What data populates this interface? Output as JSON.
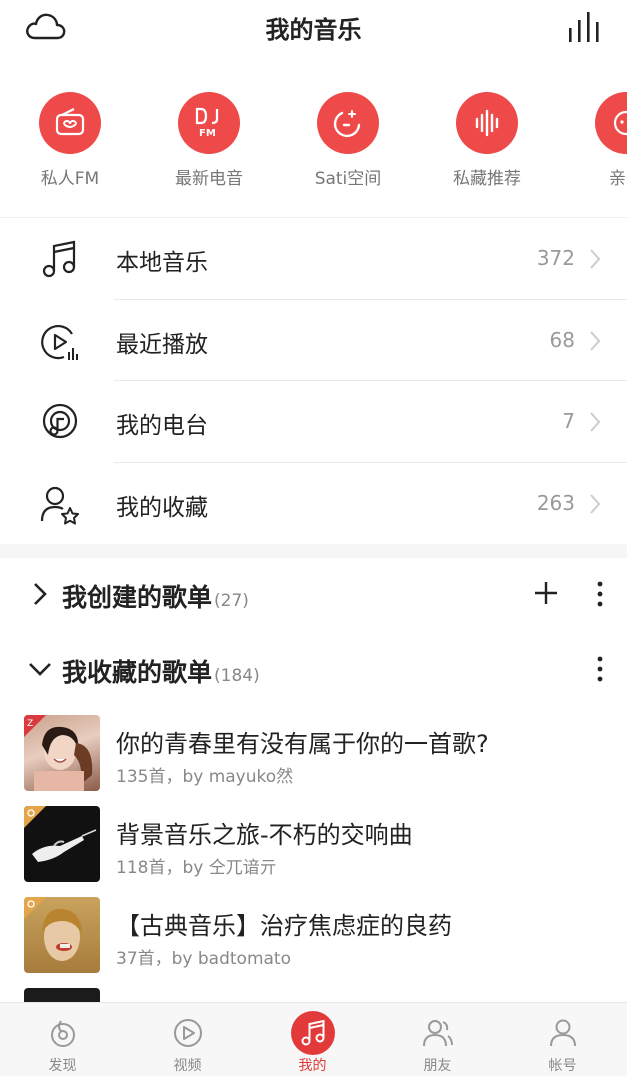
{
  "header": {
    "title": "我的音乐",
    "left_icon": "cloud-icon",
    "right_icon": "equalizer-bars-icon"
  },
  "quick_entries": [
    {
      "label": "私人FM",
      "icon": "radio-icon"
    },
    {
      "label": "最新电音",
      "icon": "dj-fm-icon"
    },
    {
      "label": "Sati空间",
      "icon": "moon-sparkle-icon"
    },
    {
      "label": "私藏推荐",
      "icon": "waveform-icon"
    },
    {
      "label": "亲子",
      "icon": "kids-face-icon"
    }
  ],
  "menu": [
    {
      "label": "本地音乐",
      "count": "372",
      "icon": "music-note-icon"
    },
    {
      "label": "最近播放",
      "count": "68",
      "icon": "recent-play-icon"
    },
    {
      "label": "我的电台",
      "count": "7",
      "icon": "podcast-icon"
    },
    {
      "label": "我的收藏",
      "count": "263",
      "icon": "user-star-icon"
    }
  ],
  "created_section": {
    "title": "我创建的歌单",
    "count": "(27)"
  },
  "collected_section": {
    "title": "我收藏的歌单",
    "count": "(184)"
  },
  "playlists": [
    {
      "name": "你的青春里有没有属于你的一首歌?",
      "meta": "135首，by mayuko然"
    },
    {
      "name": "背景音乐之旅-不朽的交响曲",
      "meta": "118首，by 仝兀谙亓"
    },
    {
      "name": "【古典音乐】治疗焦虑症的良药",
      "meta": "37首，by badtomato"
    }
  ],
  "tabs": [
    {
      "label": "发现",
      "icon": "discover-icon",
      "active": false
    },
    {
      "label": "视频",
      "icon": "video-icon",
      "active": false
    },
    {
      "label": "我的",
      "icon": "music-note-icon",
      "active": true
    },
    {
      "label": "朋友",
      "icon": "friends-icon",
      "active": false
    },
    {
      "label": "帐号",
      "icon": "account-icon",
      "active": false
    }
  ],
  "colors": {
    "accent": "#ef4a4a",
    "active_tab": "#e23a3a"
  }
}
